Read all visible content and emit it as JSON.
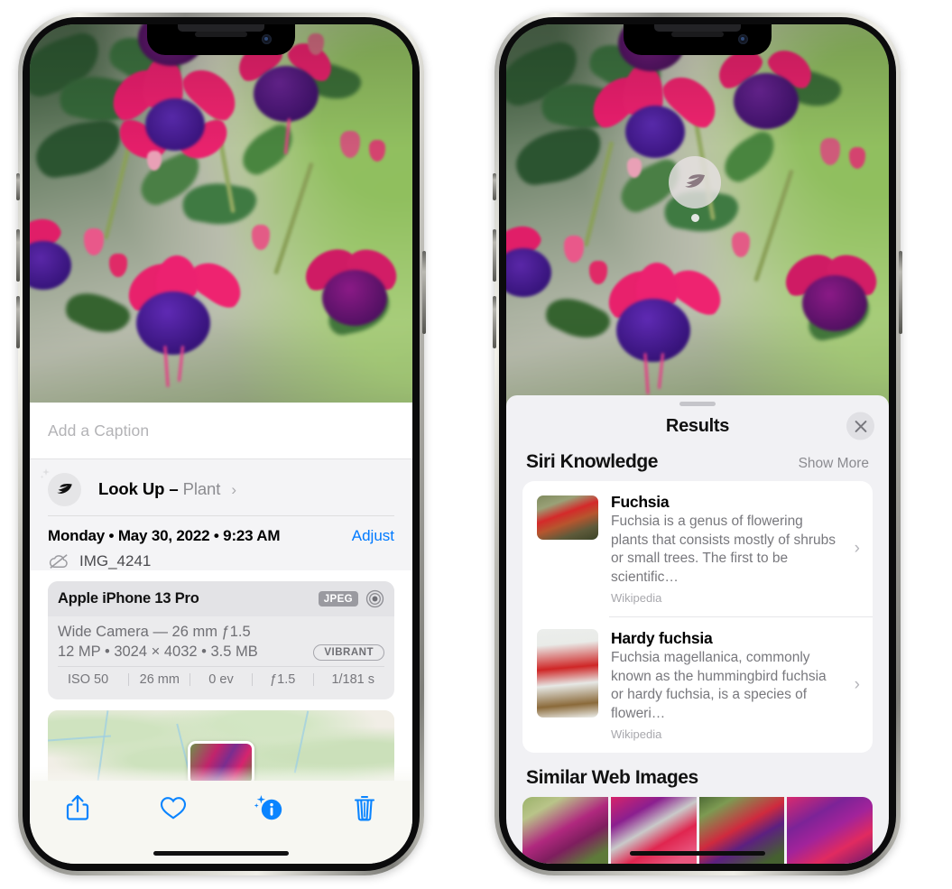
{
  "left_phone": {
    "caption": {
      "placeholder": "Add a Caption",
      "value": ""
    },
    "lookup": {
      "label": "Look Up",
      "dash": "–",
      "subject": "Plant",
      "icon": "leaf-icon",
      "chevron": "›"
    },
    "metadata": {
      "date_line": "Monday • May 30, 2022 • 9:23 AM",
      "adjust_label": "Adjust",
      "filename": "IMG_4241",
      "cloud_icon": "icloud-slash-icon"
    },
    "exif": {
      "device": "Apple iPhone 13 Pro",
      "format_tag": "JPEG",
      "aperture_icon": "camera-lens-icon",
      "lens_line": "Wide Camera — 26 mm ƒ1.5",
      "size_line": "12 MP • 3024 × 4032 • 3.5 MB",
      "style_tag": "VIBRANT",
      "stats": [
        "ISO 50",
        "26 mm",
        "0 ev",
        "ƒ1.5",
        "1/181 s"
      ]
    },
    "toolbar": [
      {
        "name": "share-button",
        "icon": "share-icon"
      },
      {
        "name": "favorite-button",
        "icon": "heart-icon"
      },
      {
        "name": "info-button",
        "icon": "info-sparkle-icon"
      },
      {
        "name": "delete-button",
        "icon": "trash-icon"
      }
    ],
    "map": {
      "thumbnail": "photo-location-thumbnail"
    }
  },
  "right_phone": {
    "visual_lookup_badge": {
      "icon": "leaf-icon"
    },
    "sheet": {
      "title": "Results",
      "close_icon": "close-icon",
      "grabber": "sheet-grabber"
    },
    "siri_knowledge": {
      "title": "Siri Knowledge",
      "show_more": "Show More",
      "items": [
        {
          "title": "Fuchsia",
          "description": "Fuchsia is a genus of flowering plants that consists mostly of shrubs or small trees. The first to be scientific…",
          "source": "Wikipedia",
          "chevron": "›"
        },
        {
          "title": "Hardy fuchsia",
          "description": "Fuchsia magellanica, commonly known as the hummingbird fuchsia or hardy fuchsia, is a species of floweri…",
          "source": "Wikipedia",
          "chevron": "›"
        }
      ]
    },
    "similar_web_images": {
      "title": "Similar Web Images",
      "count": 4
    }
  },
  "colors": {
    "accent_blue": "#007aff",
    "sheet_gray": "#f1f1f4",
    "card_white": "#ffffff",
    "muted_text": "#78787d",
    "toolbar_bg": "#f7f7f2"
  }
}
